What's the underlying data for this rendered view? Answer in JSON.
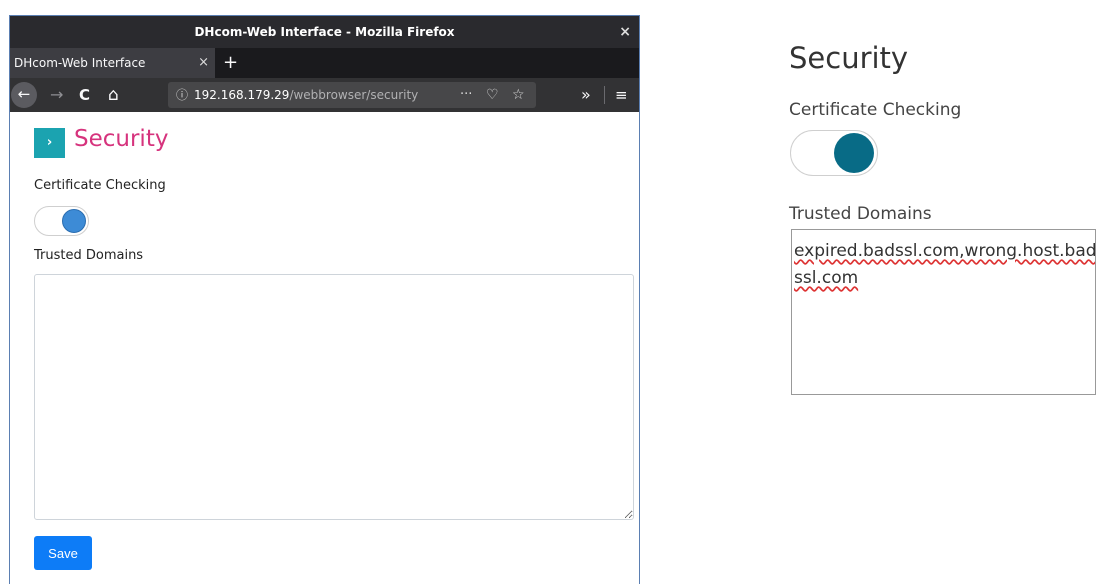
{
  "window": {
    "title": "DHcom-Web Interface - Mozilla Firefox",
    "close_glyph": "×"
  },
  "tabs": [
    {
      "label": "DHcom-Web Interface",
      "close_glyph": "×"
    }
  ],
  "new_tab_glyph": "+",
  "navbar": {
    "back_glyph": "←",
    "forward_glyph": "→",
    "reload_glyph": "C",
    "home_glyph": "⌂",
    "url_host": "192.168.179.29",
    "url_path": "/webbrowser/security",
    "info_glyph": "ⓘ",
    "page_actions_glyph": "···",
    "pocket_glyph": "♡",
    "bookmark_glyph": "☆",
    "overflow_glyph": "»",
    "menu_glyph": "≡"
  },
  "page": {
    "title": "Security",
    "chevron_glyph": "›",
    "certificate_label": "Certificate Checking",
    "certificate_checking_on": true,
    "trusted_domains_label": "Trusted Domains",
    "trusted_domains_value": "",
    "save_label": "Save"
  },
  "zoom_panel": {
    "title": "Security",
    "certificate_label": "Certificate Checking",
    "certificate_checking_on": true,
    "trusted_domains_label": "Trusted Domains",
    "trusted_domains_value": "expired.badssl.com,wrong.host.badssl.com"
  },
  "colors": {
    "accent_title": "#d6337d",
    "chevron_bg": "#1ba3b0",
    "toggle_knob_left": "#3d8bd6",
    "toggle_knob_zoom": "#086b86",
    "save_button": "#0d7cf7"
  },
  "icons": {
    "chevron": "chevron-right-icon",
    "info": "info-icon",
    "pocket": "pocket-icon",
    "bookmark": "star-icon"
  }
}
